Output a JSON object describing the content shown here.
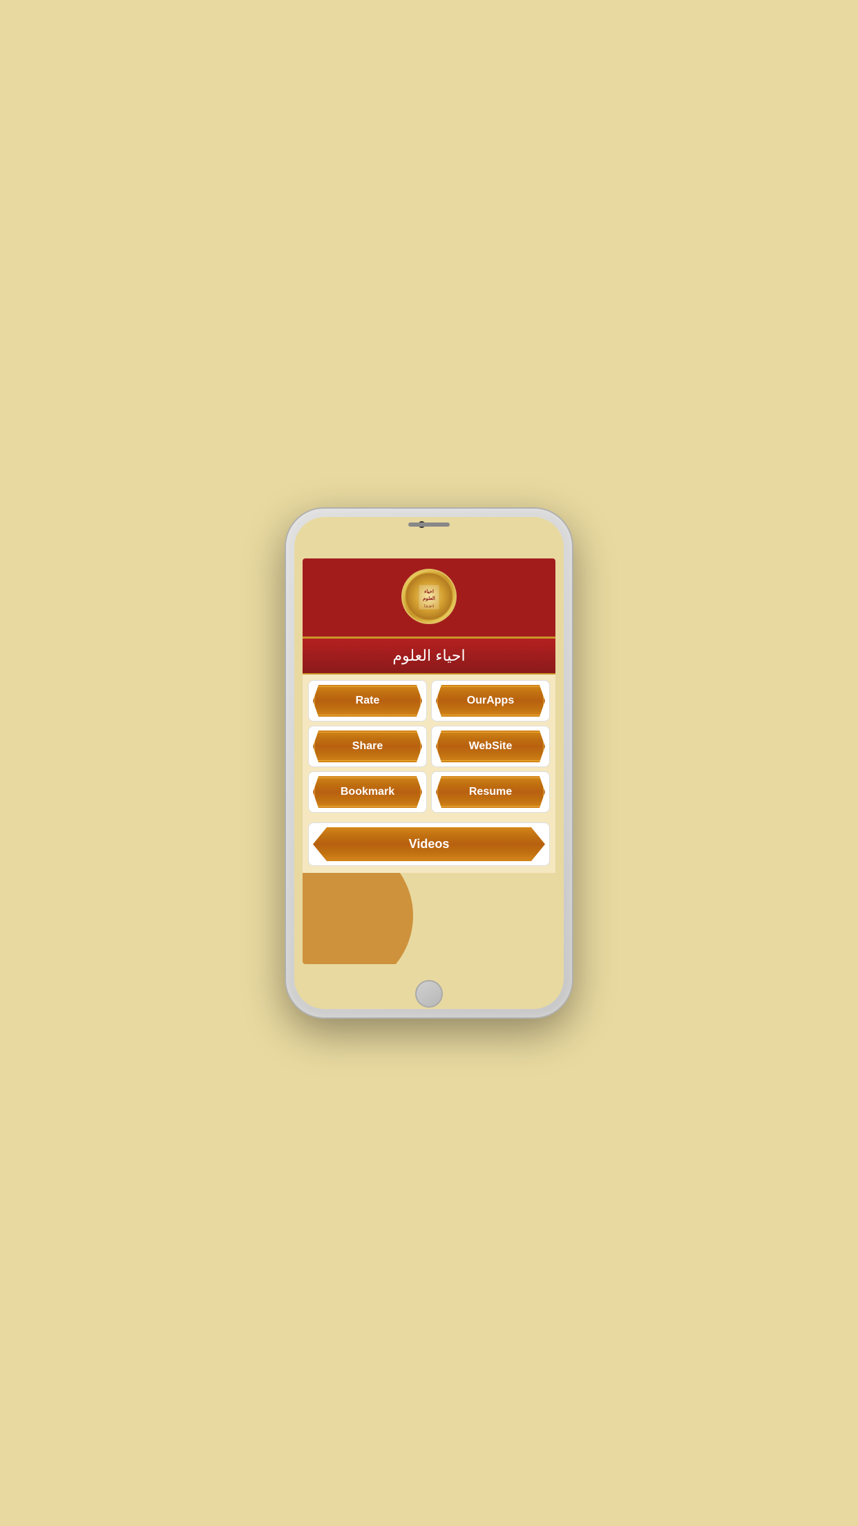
{
  "app": {
    "background_color": "#e8d9a0",
    "header": {
      "logo_alt": "Ihya ul Uloom Logo",
      "logo_urdu_text": "احياء العلوم",
      "title_urdu": "احیاء العلوم"
    },
    "buttons": [
      {
        "id": "rate",
        "label": "Rate"
      },
      {
        "id": "ourapps",
        "label": "OurApps"
      },
      {
        "id": "share",
        "label": "Share"
      },
      {
        "id": "website",
        "label": "WebSite"
      },
      {
        "id": "bookmark",
        "label": "Bookmark"
      },
      {
        "id": "resume",
        "label": "Resume"
      }
    ],
    "wide_button": {
      "id": "videos",
      "label": "Videos"
    }
  }
}
